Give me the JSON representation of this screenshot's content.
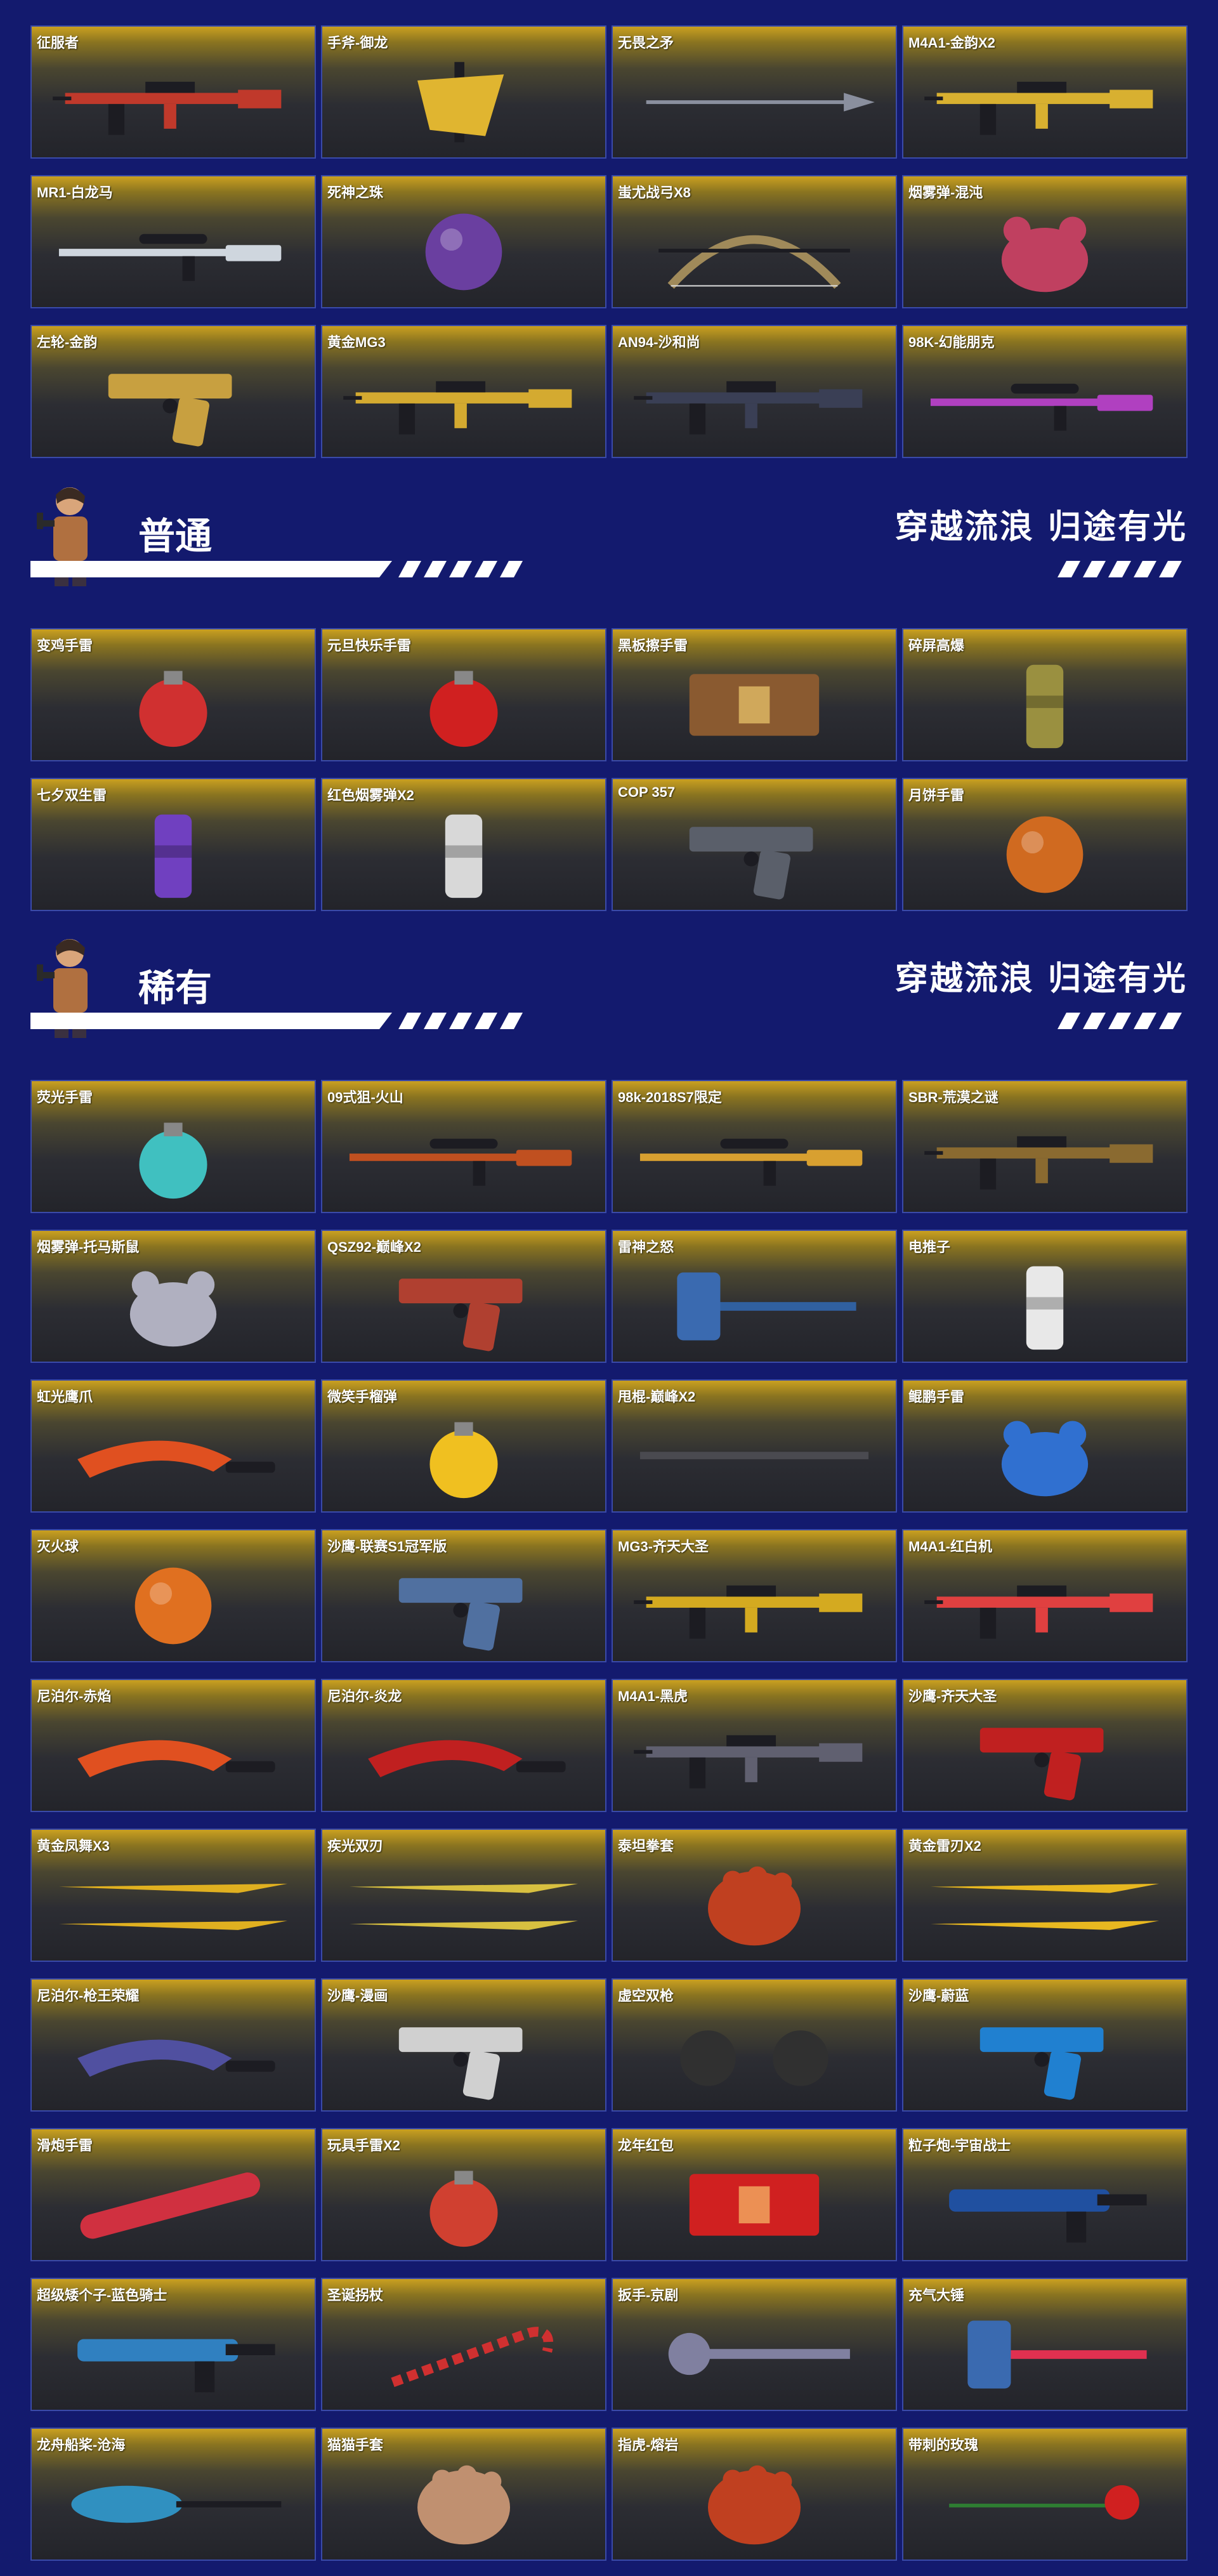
{
  "sections": [
    {
      "items": [
        {
          "label": "征服者",
          "icon": "rifle-icon",
          "color": "#c0392b"
        },
        {
          "label": "手斧-御龙",
          "icon": "axe-icon",
          "color": "#e0b530"
        },
        {
          "label": "无畏之矛",
          "icon": "spear-icon",
          "color": "#8a8f9e"
        },
        {
          "label": "M4A1-金韵X2",
          "icon": "rifle-icon",
          "color": "#d8b030"
        },
        {
          "label": "MR1-白龙马",
          "icon": "sniper-icon",
          "color": "#cfd6de"
        },
        {
          "label": "死神之珠",
          "icon": "orb-icon",
          "color": "#6a3fa0"
        },
        {
          "label": "蚩尤战弓X8",
          "icon": "bow-icon",
          "color": "#a08a5a"
        },
        {
          "label": "烟雾弹-混沌",
          "icon": "creature-icon",
          "color": "#c04060"
        },
        {
          "label": "左轮-金韵",
          "icon": "revolver-icon",
          "color": "#c8a040"
        },
        {
          "label": "黄金MG3",
          "icon": "machinegun-icon",
          "color": "#d4aa30"
        },
        {
          "label": "AN94-沙和尚",
          "icon": "rifle-icon",
          "color": "#3a3f55"
        },
        {
          "label": "98K-幻能朋克",
          "icon": "sniper-icon",
          "color": "#b040c0"
        }
      ]
    },
    {
      "banner": {
        "title": "普通",
        "slogan": "穿越流浪 归途有光"
      },
      "items": [
        {
          "label": "变鸡手雷",
          "icon": "chicken-grenade-icon",
          "color": "#d03030"
        },
        {
          "label": "元旦快乐手雷",
          "icon": "grenade-icon",
          "color": "#d02020"
        },
        {
          "label": "黑板擦手雷",
          "icon": "eraser-icon",
          "color": "#8a5a30"
        },
        {
          "label": "碎屏高爆",
          "icon": "canister-icon",
          "color": "#9a9040"
        },
        {
          "label": "七夕双生雷",
          "icon": "canister-icon",
          "color": "#7040c0"
        },
        {
          "label": "红色烟雾弹X2",
          "icon": "smoke-grenade-icon",
          "color": "#d8d8d8"
        },
        {
          "label": "COP 357",
          "icon": "pistol-icon",
          "color": "#5a5f6a"
        },
        {
          "label": "月饼手雷",
          "icon": "mooncake-icon",
          "color": "#d06a20"
        }
      ]
    },
    {
      "banner": {
        "title": "稀有",
        "slogan": "穿越流浪 归途有光"
      },
      "items": [
        {
          "label": "荧光手雷",
          "icon": "grenade-icon",
          "color": "#40c0c0"
        },
        {
          "label": "09式狙-火山",
          "icon": "sniper-icon",
          "color": "#c05020"
        },
        {
          "label": "98k-2018S7限定",
          "icon": "sniper-icon",
          "color": "#d8a030"
        },
        {
          "label": "SBR-荒漠之谜",
          "icon": "rifle-icon",
          "color": "#8a6a30"
        },
        {
          "label": "烟雾弹-托马斯鼠",
          "icon": "mouse-icon",
          "color": "#b0b0c0"
        },
        {
          "label": "QSZ92-巅峰X2",
          "icon": "pistol-icon",
          "color": "#b04030"
        },
        {
          "label": "雷神之怒",
          "icon": "hammer-icon",
          "color": "#3060a0"
        },
        {
          "label": "电推子",
          "icon": "clipper-icon",
          "color": "#e8e8e8"
        },
        {
          "label": "虹光鹰爪",
          "icon": "karambit-icon",
          "color": "#e05020"
        },
        {
          "label": "微笑手榴弹",
          "icon": "smiley-grenade-icon",
          "color": "#f0c020"
        },
        {
          "label": "甩棍-巅峰X2",
          "icon": "baton-icon",
          "color": "#4a4a50"
        },
        {
          "label": "鲲鹏手雷",
          "icon": "fish-icon",
          "color": "#3070d0"
        },
        {
          "label": "灭火球",
          "icon": "ball-icon",
          "color": "#e07020"
        },
        {
          "label": "沙鹰-联赛S1冠军版",
          "icon": "pistol-icon",
          "color": "#5070a0"
        },
        {
          "label": "MG3-齐天大圣",
          "icon": "machinegun-icon",
          "color": "#d4aa20"
        },
        {
          "label": "M4A1-红白机",
          "icon": "rifle-icon",
          "color": "#e04040"
        },
        {
          "label": "尼泊尔-赤焰",
          "icon": "kukri-icon",
          "color": "#e05020"
        },
        {
          "label": "尼泊尔-炎龙",
          "icon": "kukri-icon",
          "color": "#c02020"
        },
        {
          "label": "M4A1-黑虎",
          "icon": "rifle-icon",
          "color": "#606070"
        },
        {
          "label": "沙鹰-齐天大圣",
          "icon": "pistol-icon",
          "color": "#c02020"
        },
        {
          "label": "黄金凤舞X3",
          "icon": "double-blade-icon",
          "color": "#e0b020"
        },
        {
          "label": "疾光双刃",
          "icon": "double-blade-icon",
          "color": "#d8c040"
        },
        {
          "label": "泰坦拳套",
          "icon": "gauntlet-icon",
          "color": "#c04020"
        },
        {
          "label": "黄金雷刃X2",
          "icon": "double-blade-icon",
          "color": "#e8b820"
        },
        {
          "label": "尼泊尔-枪王荣耀",
          "icon": "kukri-icon",
          "color": "#5050a0"
        },
        {
          "label": "沙鹰-漫画",
          "icon": "pistol-icon",
          "color": "#d0d0d0"
        },
        {
          "label": "虚空双枪",
          "icon": "glove-icon",
          "color": "#303030"
        },
        {
          "label": "沙鹰-蔚蓝",
          "icon": "pistol-icon",
          "color": "#2080d0"
        },
        {
          "label": "滑炮手雷",
          "icon": "firecracker-icon",
          "color": "#d03040"
        },
        {
          "label": "玩具手雷X2",
          "icon": "toy-grenade-icon",
          "color": "#d04030"
        },
        {
          "label": "龙年红包",
          "icon": "red-envelope-icon",
          "color": "#d02020"
        },
        {
          "label": "粒子炮-宇宙战士",
          "icon": "blaster-icon",
          "color": "#2050a0"
        },
        {
          "label": "超级矮个子-蓝色骑士",
          "icon": "shotgun-icon",
          "color": "#3080c0"
        },
        {
          "label": "圣诞拐杖",
          "icon": "candy-cane-icon",
          "color": "#d03030"
        },
        {
          "label": "扳手-京剧",
          "icon": "wrench-icon",
          "color": "#8080a0"
        },
        {
          "label": "充气大锤",
          "icon": "inflatable-hammer-icon",
          "color": "#e03050"
        },
        {
          "label": "龙舟船桨-沧海",
          "icon": "paddle-icon",
          "color": "#3090c0"
        },
        {
          "label": "猫猫手套",
          "icon": "paw-icon",
          "color": "#c09070"
        },
        {
          "label": "指虎-熔岩",
          "icon": "knuckles-icon",
          "color": "#c04020"
        },
        {
          "label": "带刺的玫瑰",
          "icon": "rose-icon",
          "color": "#d02020"
        }
      ]
    }
  ]
}
